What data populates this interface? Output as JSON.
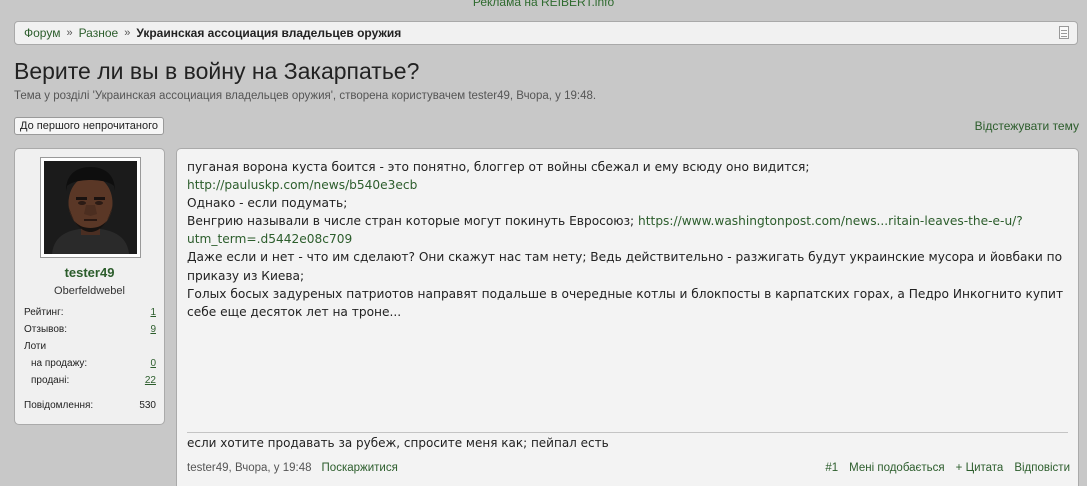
{
  "ad_text": "Реклама на REIBERT.info",
  "breadcrumb": {
    "items": [
      "Форум",
      "Разное",
      "Украинская ассоциация владельцев оружия"
    ],
    "separator": "»"
  },
  "thread": {
    "title": "Верите ли вы в войну на Закарпатье?",
    "meta": "Тема у розділі 'Украинская ассоциация владельцев оружия', створена користувачем tester49, Вчора, у 19:48.",
    "first_unread_label": "До першого непрочитаного",
    "watch_label": "Відстежувати тему"
  },
  "user": {
    "name": "tester49",
    "title": "Oberfeldwebel",
    "rating_label": "Рейтинг:",
    "rating_value": "1",
    "reviews_label": "Отзывов:",
    "reviews_value": "9",
    "lots_label": "Лоти",
    "for_sale_label": "на продажу:",
    "for_sale_value": "0",
    "sold_label": "продані:",
    "sold_value": "22",
    "messages_label": "Повідомлення:",
    "messages_value": "530"
  },
  "post": {
    "line1": "пуганая ворона куста боится - это понятно, блоггер от войны сбежал и ему всюду оно видится;",
    "link1": "http://pauluskp.com/news/b540e3ecb",
    "line2": "Однако - если подумать;",
    "line3_text": "Венгрию называли в числе стран которые могут покинуть Евросоюз; ",
    "link2": "https://www.washingtonpost.com/news...ritain-leaves-the-e-u/?utm_term=.d5442e08c709",
    "line4": "Даже если и нет - что им сделают? Они скажут нас там нету; Ведь действительно - разжигать будут украинские мусора и йовбаки по приказу из Киева;",
    "line5": "Голых босых задуреных патриотов направят подальше в очередные котлы и блокпосты в карпатских горах, а Педро Инкогнито купит себе еще десяток лет на троне...",
    "signature": "если хотите продавать за рубеж, спросите меня как; пейпал есть",
    "author_date": "tester49, Вчора, у 19:48",
    "report_label": "Поскаржитися",
    "post_number": "#1",
    "like_label": "Мені подобається",
    "quote_label": "+ Цитата",
    "reply_label": "Відповісти"
  },
  "colors": {
    "link": "#2c5d2c",
    "background": "#c8c8c8",
    "panel": "#f3f3f3"
  },
  "icons": {
    "avatar": "user-avatar-photo",
    "page": "page-icon"
  }
}
